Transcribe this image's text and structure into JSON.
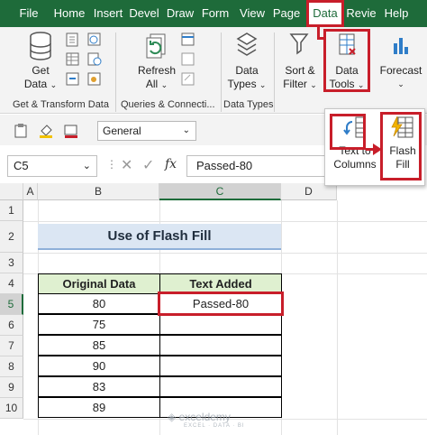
{
  "tabs": [
    "File",
    "Home",
    "Insert",
    "Devel",
    "Draw",
    "Form",
    "View",
    "Page",
    "Data",
    "Revie",
    "Help"
  ],
  "active_tab": "Data",
  "ribbon": {
    "get_data": "Get\nData",
    "refresh_all": "Refresh\nAll",
    "data_types": "Data\nTypes",
    "sort_filter": "Sort &\nFilter",
    "data_tools": "Data\nTools",
    "forecast": "Forecast",
    "groups": {
      "get_transform": "Get & Transform Data",
      "queries": "Queries & Connecti...",
      "data_types": "Data Types"
    }
  },
  "number_format": "General",
  "popup": {
    "text_to_columns": "Text to\nColumns",
    "flash_fill": "Flash\nFill"
  },
  "formula_bar": {
    "name_box": "C5",
    "fx": "fx",
    "content": "Passed-80"
  },
  "grid": {
    "columns": [
      "A",
      "B",
      "C",
      "D"
    ],
    "rows": [
      "1",
      "2",
      "3",
      "4",
      "5",
      "6",
      "7",
      "8",
      "9",
      "10"
    ],
    "selected_column": "C",
    "selected_row": "5"
  },
  "sheet": {
    "title": "Use of Flash Fill",
    "headers": [
      "Original Data",
      "Text Added"
    ],
    "rows": [
      [
        "80",
        "Passed-80"
      ],
      [
        "75",
        ""
      ],
      [
        "85",
        ""
      ],
      [
        "90",
        ""
      ],
      [
        "83",
        ""
      ],
      [
        "89",
        ""
      ]
    ]
  },
  "watermark": {
    "name": "exceldemy",
    "tagline": "EXCEL · DATA · BI"
  },
  "colors": {
    "excel_green": "#1e6b3a",
    "highlight_red": "#c81e2a",
    "header_fill": "#dff0d0",
    "title_fill": "#dbe6f3"
  }
}
